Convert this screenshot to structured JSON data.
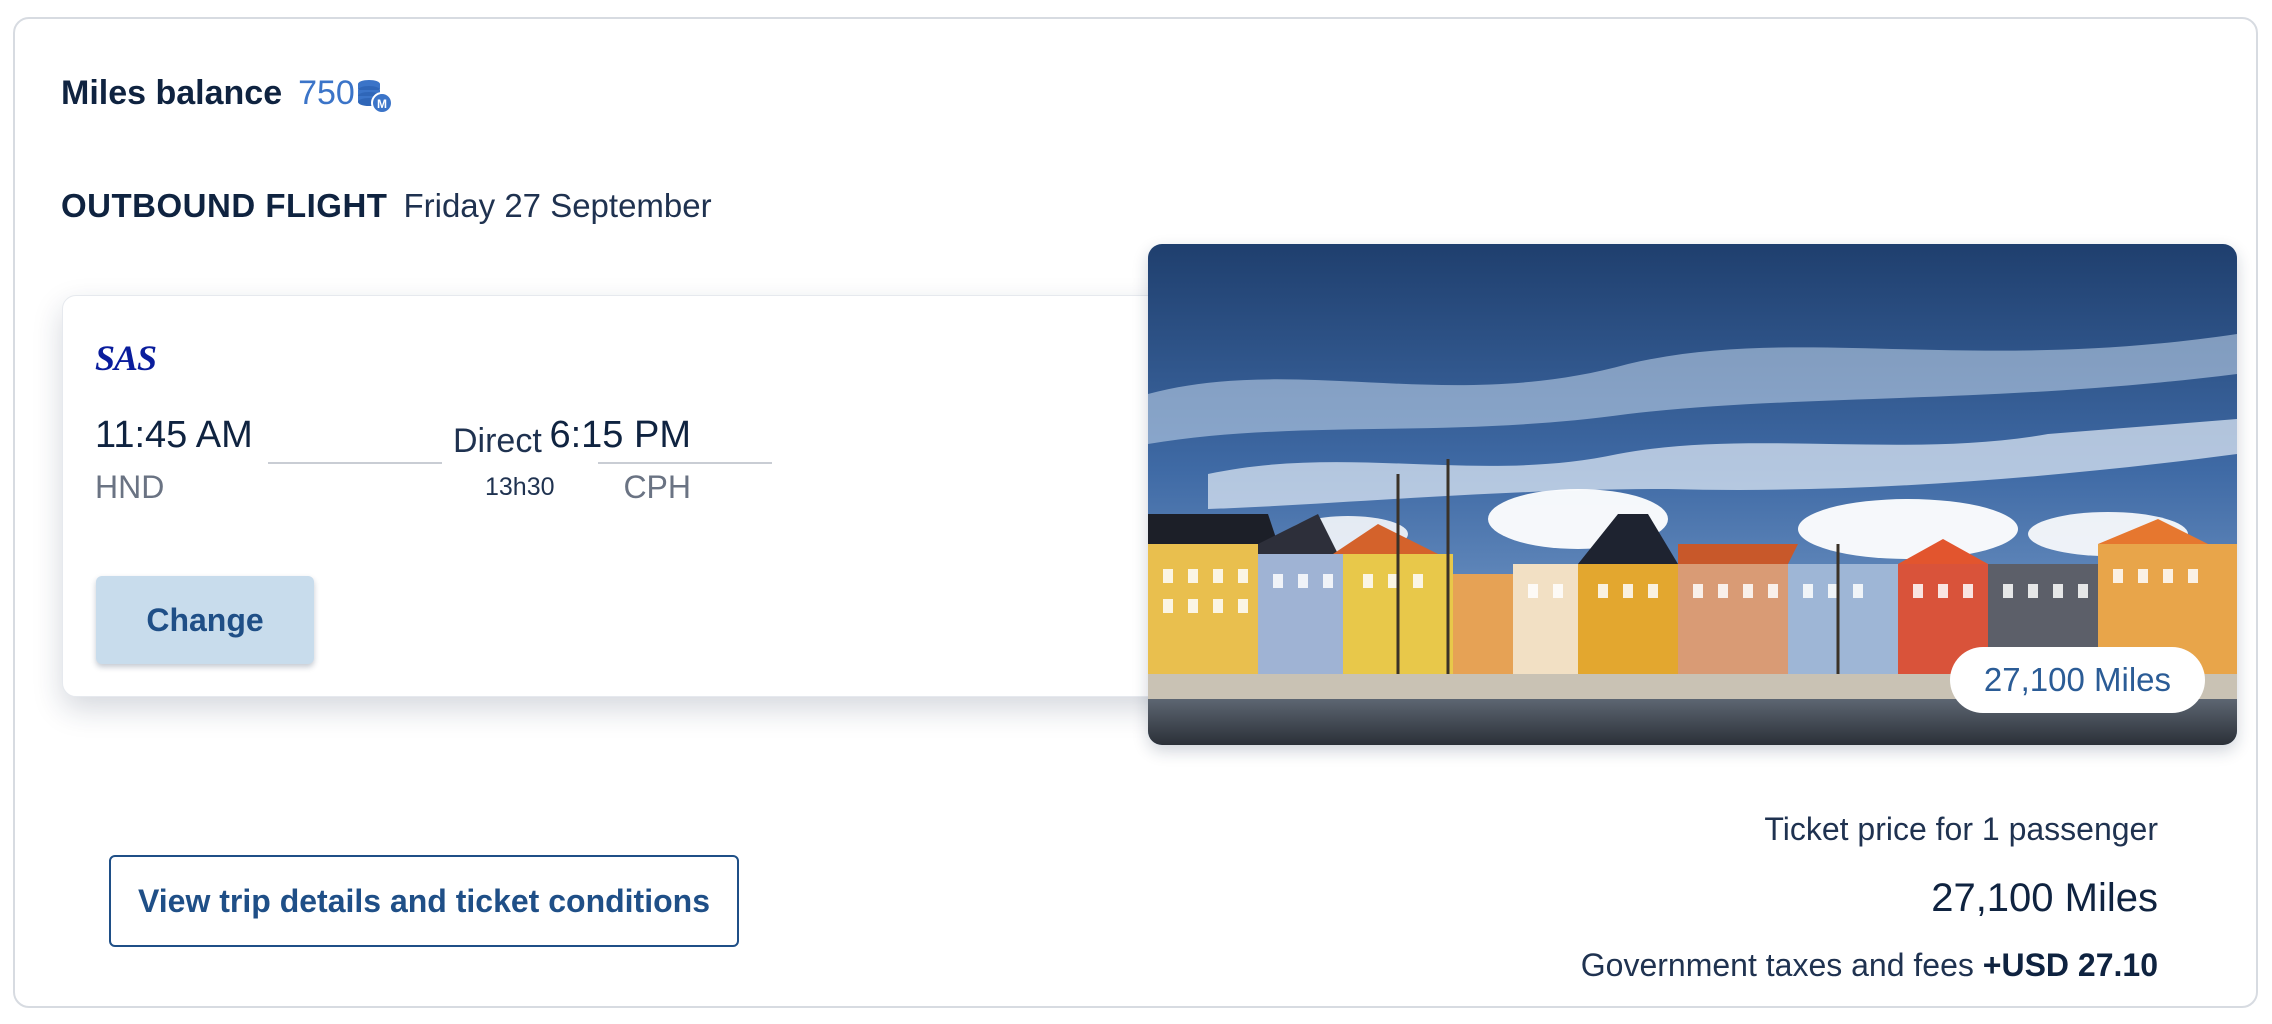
{
  "header": {
    "miles_balance_label": "Miles balance",
    "miles_balance_value": "750",
    "miles_icon": "miles-coins-icon"
  },
  "outbound": {
    "label": "OUTBOUND FLIGHT",
    "date": "Friday 27 September"
  },
  "flight": {
    "airline_logo": "SAS",
    "departure_time": "11:45 AM",
    "departure_code": "HND",
    "stop_type": "Direct",
    "duration": "13h30",
    "arrival_time": "6:15 PM",
    "arrival_code": "CPH",
    "change_label": "Change"
  },
  "destination_image": {
    "badge": "27,100 Miles"
  },
  "footer": {
    "view_details_label": "View trip details and ticket conditions",
    "price_caption": "Ticket price for 1 passenger",
    "price_amount": "27,100 Miles",
    "fees_label": "Government taxes and fees",
    "fees_value": "+USD 27.10"
  },
  "colors": {
    "brand_blue": "#1f4f87",
    "accent_blue": "#3b74c8",
    "button_bg": "#c8dcec",
    "sas_blue": "#0a1d9c"
  }
}
